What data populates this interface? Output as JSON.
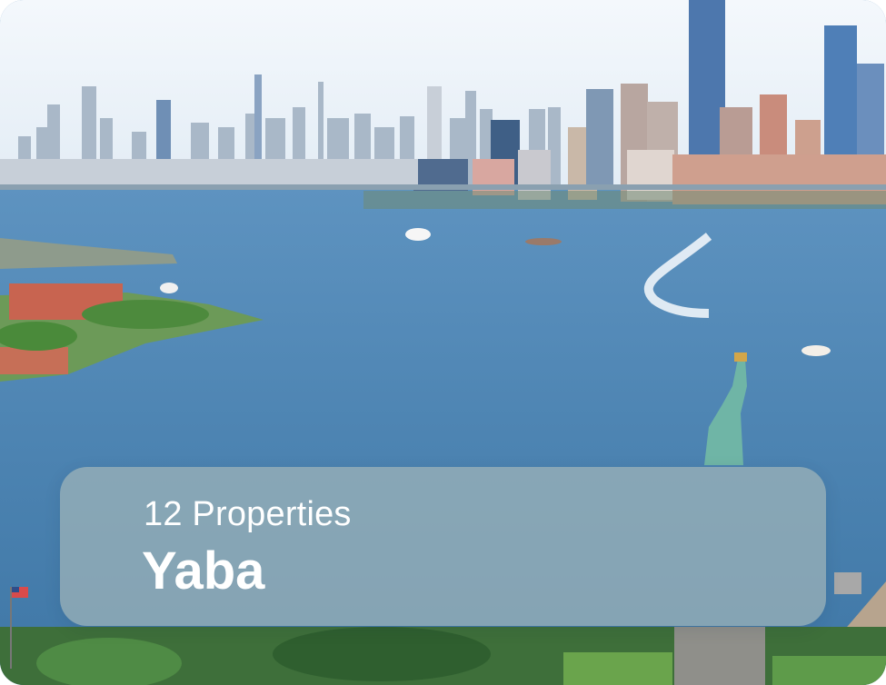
{
  "card": {
    "count_label": "12 Properties",
    "location_name": "Yaba"
  },
  "image": {
    "subject": "new-york-harbor-skyline"
  },
  "colors": {
    "overlay": "#a0b4b9",
    "text": "#ffffff",
    "water": "#4f86b3",
    "sky": "#eef4fa"
  }
}
